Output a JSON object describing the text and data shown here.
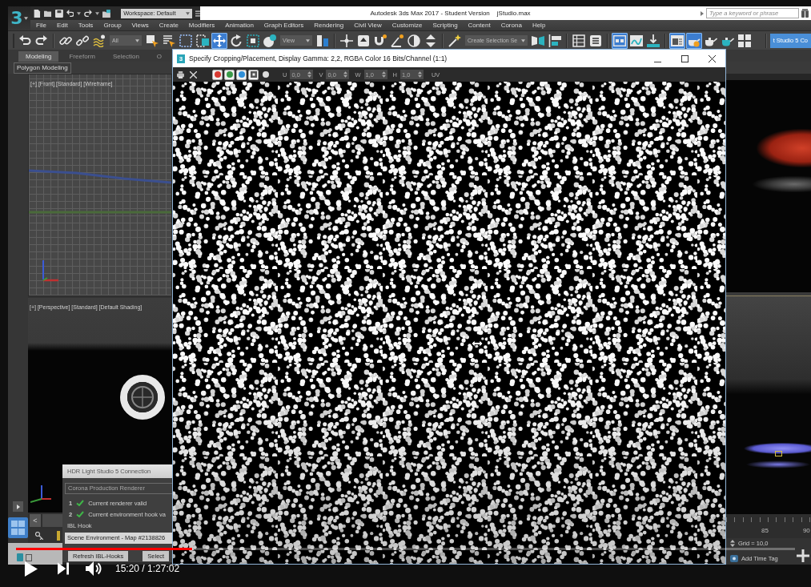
{
  "app": {
    "logo": "3",
    "workspace": "Workspace: Default",
    "title": "Autodesk 3ds Max 2017 - Student Version",
    "file": "jStudio.max",
    "search": {
      "placeholder": "Type a keyword or phrase"
    }
  },
  "menu": [
    "File",
    "Edit",
    "Tools",
    "Group",
    "Views",
    "Create",
    "Modifiers",
    "Animation",
    "Graph Editors",
    "Rendering",
    "Civil View",
    "Customize",
    "Scripting",
    "Content",
    "Corona",
    "Help"
  ],
  "toolbar": [
    {
      "kind": "tool",
      "selected": false
    },
    {
      "kind": "tool",
      "selected": false
    },
    {
      "kind": "tool",
      "selected": false
    },
    {
      "kind": "tool",
      "selected": false
    },
    {
      "kind": "tool",
      "selected": false
    },
    {
      "kind": "dropdown",
      "value": "All"
    },
    {
      "kind": "tool",
      "selected": false
    },
    {
      "kind": "tool",
      "selected": false
    },
    {
      "kind": "tool",
      "selected": false
    },
    {
      "kind": "tool",
      "selected": false
    },
    {
      "kind": "tool",
      "selected": true
    },
    {
      "kind": "tool",
      "selected": false
    },
    {
      "kind": "tool",
      "selected": false
    },
    {
      "kind": "tool",
      "selected": false
    },
    {
      "kind": "dropdown",
      "value": "View"
    },
    {
      "kind": "tool",
      "selected": false
    },
    {
      "kind": "tool",
      "selected": false
    },
    {
      "kind": "tool",
      "selected": false
    },
    {
      "kind": "tool",
      "selected": false
    },
    {
      "kind": "tool",
      "selected": false
    },
    {
      "kind": "tool",
      "selected": false
    },
    {
      "kind": "tool",
      "selected": false
    },
    {
      "kind": "tool",
      "selected": false
    },
    {
      "kind": "dropdown",
      "value": "Create Selection Se"
    },
    {
      "kind": "tool",
      "selected": false
    },
    {
      "kind": "tool",
      "selected": false
    },
    {
      "kind": "tool",
      "selected": false
    },
    {
      "kind": "tool",
      "selected": false
    },
    {
      "kind": "tool",
      "selected": true
    },
    {
      "kind": "tool",
      "selected": false
    },
    {
      "kind": "tool",
      "selected": false
    },
    {
      "kind": "tool",
      "selected": true
    },
    {
      "kind": "tool",
      "selected": true
    },
    {
      "kind": "tool",
      "selected": false
    },
    {
      "kind": "tool",
      "selected": false
    },
    {
      "kind": "tool",
      "selected": false
    },
    {
      "kind": "button",
      "label": "t Studio 5 Co"
    }
  ],
  "ribbon": {
    "tabs": [
      {
        "label": "Modeling",
        "selected": true
      },
      {
        "label": "Freeform",
        "selected": false
      },
      {
        "label": "Selection",
        "selected": false
      },
      {
        "label": "O",
        "selected": false
      }
    ],
    "panel": "Polygon Modeling"
  },
  "viewports": [
    {
      "label": "[+] [Front] [Standard] [Wireframe]"
    },
    {
      "label": "[+] [Perspective] [Standard] [Default Shading]"
    }
  ],
  "timeline": {
    "prev": "<",
    "ticks": [
      "85",
      "90"
    ],
    "grid": "Grid = 10,0",
    "time_tag": "Add Time Tag"
  },
  "dialog": {
    "icon": "3",
    "title": "Specify Cropping/Placement, Display Gamma: 2,2, RGBA Color 16 Bits/Channel (1:1)",
    "channels": [
      {
        "kind": "color",
        "color": "#d83a32",
        "on": true
      },
      {
        "kind": "color",
        "color": "#3a9a48",
        "on": true
      },
      {
        "kind": "color",
        "color": "#2f8fd8",
        "on": true
      },
      {
        "kind": "alpha",
        "on": true
      },
      {
        "kind": "mono",
        "on": false
      }
    ],
    "fields": [
      {
        "label": "U",
        "value": "0,0"
      },
      {
        "label": "V",
        "value": "0,0"
      },
      {
        "label": "W",
        "value": "1,0"
      },
      {
        "label": "H",
        "value": "1,0"
      }
    ],
    "uv": "UV"
  },
  "hdr_panel": {
    "title": "HDR Light Studio 5 Connection",
    "renderer": "Corona Production Renderer",
    "checks": [
      {
        "number": "1",
        "text": "Current renderer valid",
        "valid": true
      },
      {
        "number": "2",
        "text": "Current environment hook va",
        "valid": true
      }
    ],
    "hook_label": "IBL Hook",
    "hook_value": "Scene Environment - Map #2138826",
    "buttons": [
      "Refresh IBL-Hooks",
      "Select"
    ]
  },
  "player": {
    "level": 0.226,
    "time": "15:20 / 1:27:02"
  }
}
